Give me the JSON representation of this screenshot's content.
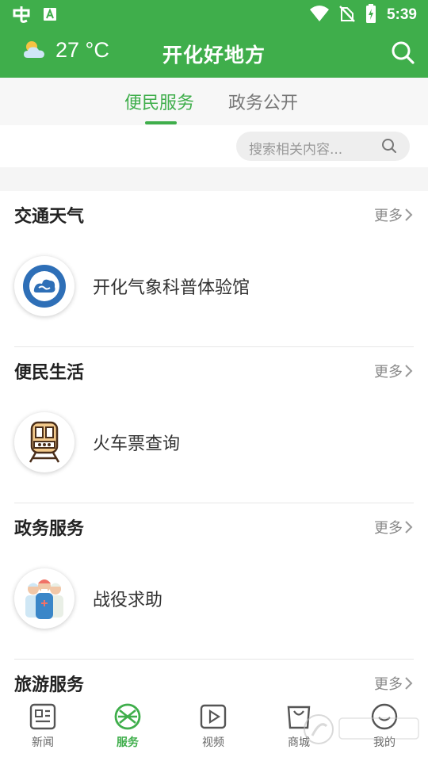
{
  "status_bar": {
    "time": "5:39",
    "icons": [
      "app-notification-icon",
      "text-input-icon",
      "wifi-icon",
      "no-sim-icon",
      "battery-charging-icon"
    ]
  },
  "header": {
    "temperature": "27 °C",
    "weather_icon": "partly-cloudy-icon",
    "title": "开化好地方",
    "search_icon": "search-icon",
    "color": "#3fae4b"
  },
  "tabs": [
    {
      "label": "便民服务",
      "active": true
    },
    {
      "label": "政务公开",
      "active": false
    }
  ],
  "search": {
    "placeholder": "搜索相关内容..."
  },
  "sections": [
    {
      "title": "交通天气",
      "more": "更多",
      "item": {
        "label": "开化气象科普体验馆",
        "icon": "weather-museum-logo"
      }
    },
    {
      "title": "便民生活",
      "more": "更多",
      "item": {
        "label": "火车票查询",
        "icon": "train-icon"
      }
    },
    {
      "title": "政务服务",
      "more": "更多",
      "item": {
        "label": "战役求助",
        "icon": "medical-workers-icon"
      }
    },
    {
      "title": "旅游服务",
      "more": "更多"
    }
  ],
  "bottom_nav": [
    {
      "label": "新闻",
      "icon": "news-icon",
      "active": false
    },
    {
      "label": "服务",
      "icon": "service-icon",
      "active": true
    },
    {
      "label": "视频",
      "icon": "video-icon",
      "active": false
    },
    {
      "label": "商城",
      "icon": "shop-icon",
      "active": false
    },
    {
      "label": "我的",
      "icon": "profile-icon",
      "active": false
    }
  ]
}
